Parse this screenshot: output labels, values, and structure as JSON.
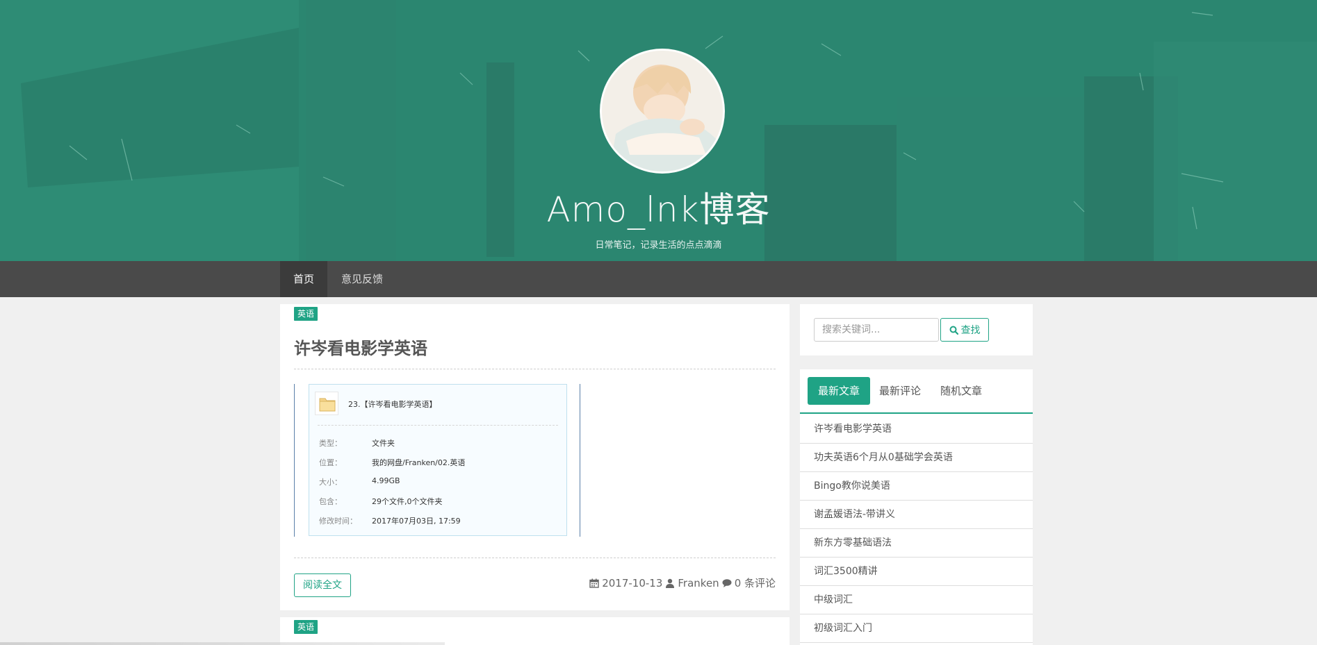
{
  "header": {
    "site_title": "Amo_lnk博客",
    "subtitle": "日常笔记，记录生活的点点滴滴"
  },
  "nav": {
    "items": [
      {
        "label": "首页",
        "active": true
      },
      {
        "label": "意见反馈",
        "active": false
      }
    ]
  },
  "post": {
    "tag": "英语",
    "title": "许岑看电影学英语",
    "share": {
      "folder_icon": "folder-icon",
      "name": "23.【许岑看电影学英语】",
      "rows": [
        {
          "key": "类型：",
          "value": "文件夹"
        },
        {
          "key": "位置：",
          "value": "我的网盘/Franken/02.英语"
        },
        {
          "key": "大小：",
          "value": "4.99GB"
        },
        {
          "key": "包含：",
          "value": "29个文件,0个文件夹"
        },
        {
          "key": "修改时间：",
          "value": "2017年07月03日, 17:59"
        }
      ]
    },
    "read_more": "阅读全文",
    "meta": {
      "date": "2017-10-13",
      "author": "Franken",
      "comments": "0 条评论"
    }
  },
  "post2": {
    "tag": "英语"
  },
  "sidebar": {
    "search": {
      "placeholder": "搜索关键词...",
      "button": "查找"
    },
    "tabs": [
      {
        "label": "最新文章",
        "active": true
      },
      {
        "label": "最新评论",
        "active": false
      },
      {
        "label": "随机文章",
        "active": false
      }
    ],
    "latest": [
      "许岑看电影学英语",
      "功夫英语6个月从0基础学会英语",
      "Bingo教你说美语",
      "谢孟媛语法-带讲义",
      "新东方零基础语法",
      "词汇3500精讲",
      "中级词汇",
      "初级词汇入门"
    ]
  },
  "colors": {
    "accent": "#1fa385",
    "hero": "#2a7f6b",
    "nav": "#4a4a4a"
  }
}
